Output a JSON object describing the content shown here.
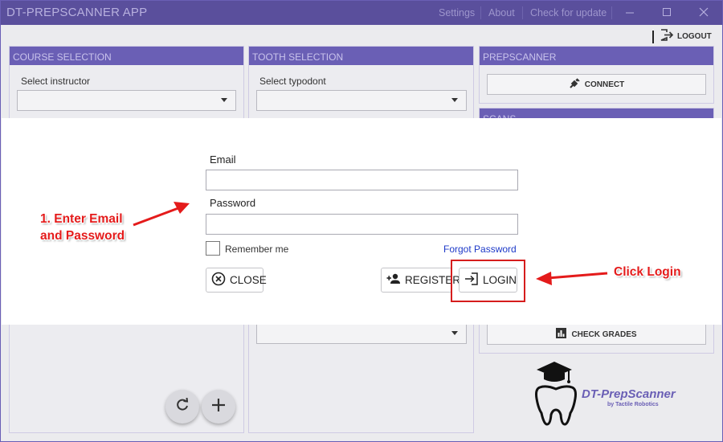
{
  "titlebar": {
    "app_title": "DT-PREPSCANNER APP",
    "menu": [
      "Settings",
      "About",
      "Check for update"
    ]
  },
  "header": {
    "logout_label": "LOGOUT"
  },
  "panels": {
    "course": {
      "title": "COURSE SELECTION",
      "field_label": "Select instructor"
    },
    "tooth": {
      "title": "TOOTH SELECTION",
      "field_label": "Select typodont"
    },
    "prepscanner": {
      "title": "PREPSCANNER",
      "connect_label": "CONNECT",
      "scans_title": "SCANS",
      "check_grades_label": "CHECK GRADES"
    }
  },
  "brand": {
    "name": "DT-PrepScanner",
    "tagline": "by Tactile Robotics"
  },
  "login": {
    "email_label": "Email",
    "email_value": "",
    "password_label": "Password",
    "password_value": "",
    "remember_label": "Remember me",
    "forgot_label": "Forgot Password",
    "close_label": "CLOSE",
    "register_label": "REGISTER",
    "login_label": "LOGIN"
  },
  "annotations": {
    "step1_line1": "1. Enter Email",
    "step1_line2": "and Password",
    "click_login": "Click Login"
  },
  "colors": {
    "accent": "#6a5fb5",
    "titlebar": "#5a4f9c",
    "annotation": "#e41b1b",
    "link": "#1d39c8"
  },
  "icons": [
    "logout-icon",
    "plug-icon",
    "chart-icon",
    "refresh-icon",
    "plus-icon",
    "close-circle-icon",
    "add-person-icon",
    "login-icon",
    "tooth-logo-icon"
  ]
}
